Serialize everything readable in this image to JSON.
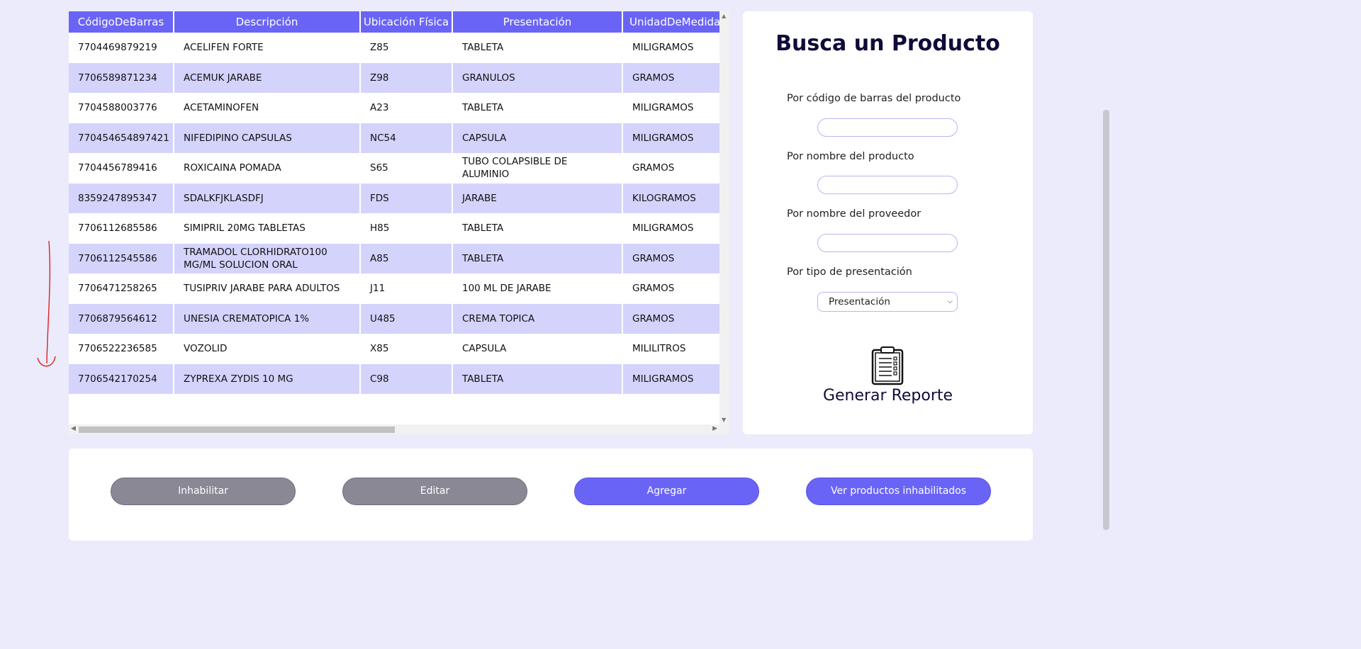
{
  "table": {
    "headers": [
      "CódigoDeBarras",
      "Descripción",
      "Ubicación Física",
      "Presentación",
      "UnidadDeMedida"
    ],
    "rows": [
      [
        "7704469879219",
        "ACELIFEN FORTE",
        "Z85",
        "TABLETA",
        "MILIGRAMOS"
      ],
      [
        "7706589871234",
        "ACEMUK JARABE",
        "Z98",
        "GRANULOS",
        "GRAMOS"
      ],
      [
        "7704588003776",
        "ACETAMINOFEN",
        "A23",
        "TABLETA",
        "MILIGRAMOS"
      ],
      [
        "770454654897421",
        "NIFEDIPINO CAPSULAS",
        "NC54",
        "CAPSULA",
        "MILIGRAMOS"
      ],
      [
        "7704456789416",
        "ROXICAINA POMADA",
        "S65",
        "TUBO COLAPSIBLE DE ALUMINIO",
        "GRAMOS"
      ],
      [
        "8359247895347",
        "SDALKFJKLASDFJ",
        "FDS",
        "JARABE",
        "KILOGRAMOS"
      ],
      [
        "7706112685586",
        "SIMIPRIL 20MG TABLETAS",
        "H85",
        "TABLETA",
        "MILIGRAMOS"
      ],
      [
        "7706112545586",
        "TRAMADOL CLORHIDRATO100 MG/ML SOLUCION ORAL",
        "A85",
        "TABLETA",
        "GRAMOS"
      ],
      [
        "7706471258265",
        "TUSIPRIV JARABE PARA ADULTOS",
        "J11",
        "100 ML DE JARABE",
        "GRAMOS"
      ],
      [
        "7706879564612",
        "UNESIA CREMATOPICA 1%",
        "U485",
        "CREMA TOPICA",
        "GRAMOS"
      ],
      [
        "7706522236585",
        "VOZOLID",
        "X85",
        "CAPSULA",
        "MILILITROS"
      ],
      [
        "7706542170254",
        "ZYPREXA ZYDIS 10 MG",
        "C98",
        "TABLETA",
        "MILIGRAMOS"
      ]
    ]
  },
  "search": {
    "title": "Busca un Producto",
    "barcode_label": "Por código de barras del producto",
    "name_label": "Por nombre del producto",
    "supplier_label": "Por nombre del proveedor",
    "presentation_label": "Por tipo de presentación",
    "presentation_selected": "Presentación",
    "report_label": "Generar Reporte"
  },
  "actions": {
    "disable": "Inhabilitar",
    "edit": "Editar",
    "add": "Agregar",
    "view_disabled": "Ver productos inhabilitados"
  },
  "colors": {
    "accent": "#6a64f6",
    "row_alt": "#d4d3fc",
    "page_bg": "#ebebfc",
    "button_gray": "#8a8894"
  }
}
